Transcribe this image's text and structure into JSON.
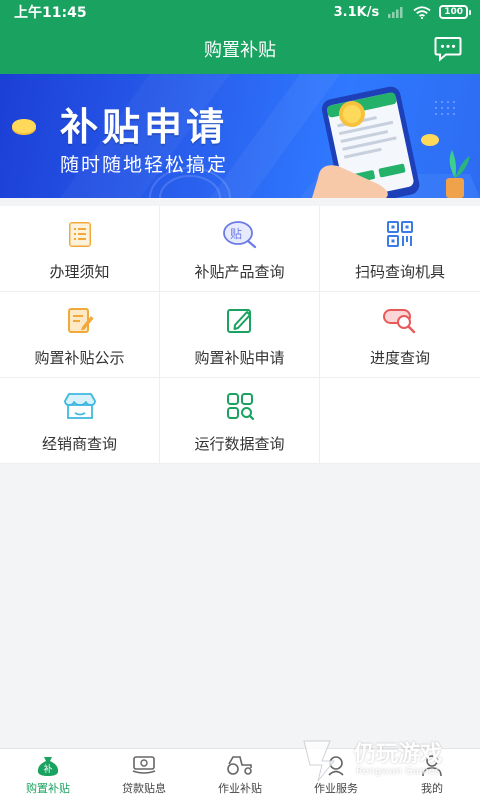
{
  "status": {
    "time": "上午11:45",
    "speed": "3.1K/s",
    "battery": "100"
  },
  "header": {
    "title": "购置补贴",
    "message_icon": "chat-bubble-icon"
  },
  "banner": {
    "title": "补贴申请",
    "subtitle": "随时随地轻松搞定"
  },
  "menu": [
    {
      "label": "办理须知",
      "icon": "clipboard-list-icon",
      "color": "#f2a93b"
    },
    {
      "label": "补贴产品查询",
      "icon": "subsidy-search-icon",
      "color": "#6b7be6"
    },
    {
      "label": "扫码查询机具",
      "icon": "qr-code-icon",
      "color": "#3a7be6"
    },
    {
      "label": "购置补贴公示",
      "icon": "notice-edit-icon",
      "color": "#f2a93b"
    },
    {
      "label": "购置补贴申请",
      "icon": "edit-form-icon",
      "color": "#1aa260"
    },
    {
      "label": "进度查询",
      "icon": "progress-search-icon",
      "color": "#e85a5a"
    },
    {
      "label": "经销商查询",
      "icon": "store-icon",
      "color": "#3fb8e0"
    },
    {
      "label": "运行数据查询",
      "icon": "grid-search-icon",
      "color": "#1aa260"
    }
  ],
  "tabs": [
    {
      "label": "购置补贴",
      "icon": "subsidy-bag-icon",
      "active": true
    },
    {
      "label": "贷款贴息",
      "icon": "money-icon",
      "active": false
    },
    {
      "label": "作业补贴",
      "icon": "tractor-icon",
      "active": false
    },
    {
      "label": "作业服务",
      "icon": "service-icon",
      "active": false
    },
    {
      "label": "我的",
      "icon": "user-icon",
      "active": false
    }
  ],
  "watermark": {
    "text": "仍玩游戏",
    "sub": "Rengwan Games"
  },
  "colors": {
    "primary": "#1aa260",
    "banner": "#2a63f0",
    "background": "#f2f4f6"
  }
}
